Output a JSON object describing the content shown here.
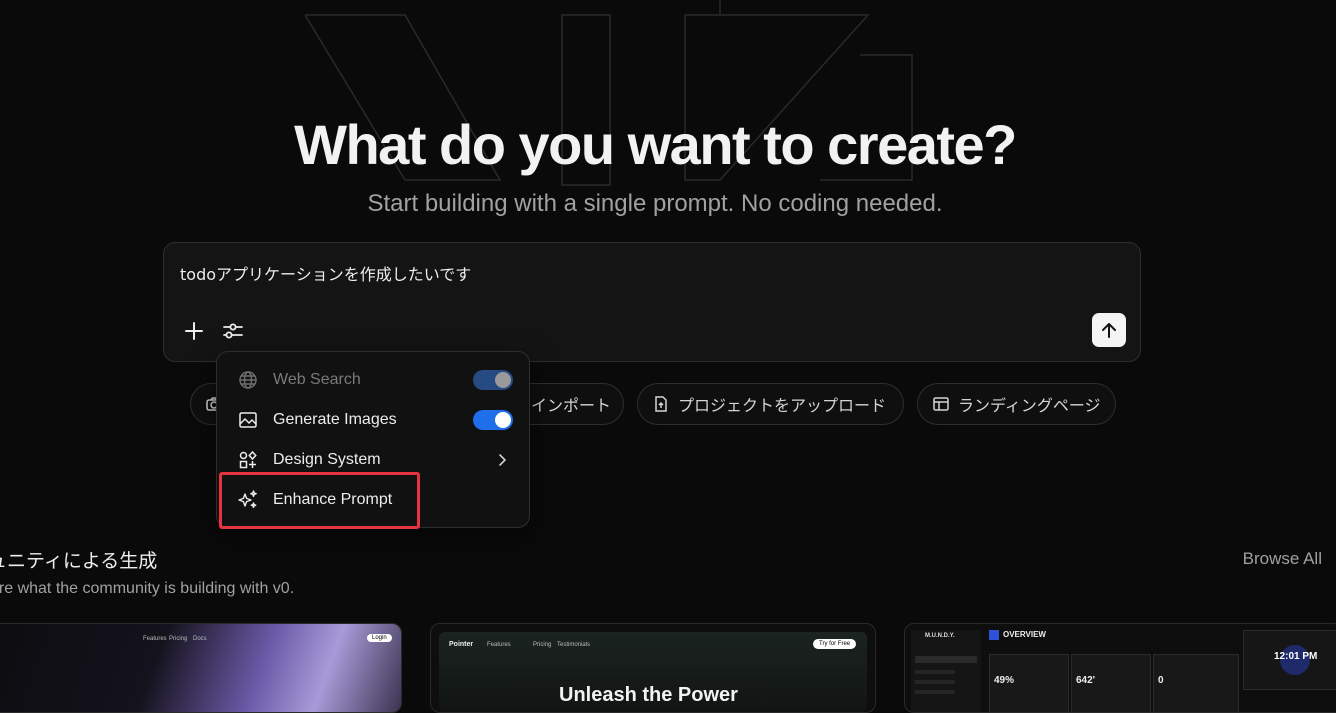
{
  "hero": {
    "title": "What do you want to create?",
    "subtitle": "Start building with a single prompt. No coding needed."
  },
  "prompt": {
    "value": "todoアプリケーションを作成したいです"
  },
  "chips": [
    {
      "label": "",
      "icon": "camera-icon"
    },
    {
      "label": "インポート",
      "icon": "import-icon"
    },
    {
      "label": "プロジェクトをアップロード",
      "icon": "file-upload-icon"
    },
    {
      "label": "ランディングページ",
      "icon": "layout-icon"
    }
  ],
  "menu": {
    "items": [
      {
        "label": "Web Search",
        "icon": "globe-icon",
        "toggle": true,
        "disabled": true
      },
      {
        "label": "Generate Images",
        "icon": "image-icon",
        "toggle": true,
        "disabled": false
      },
      {
        "label": "Design System",
        "icon": "shapes-icon",
        "submenu": true
      },
      {
        "label": "Enhance Prompt",
        "icon": "sparkles-icon"
      }
    ]
  },
  "community": {
    "title": "ュニティによる生成",
    "subtitle": "ore what the community is building with v0.",
    "browse_all": "Browse All"
  },
  "cards": [
    {
      "nav": [
        "Features",
        "Pricing",
        "Docs"
      ],
      "button": "Login"
    },
    {
      "brand": "Pointer",
      "nav": [
        "Features",
        "Pricing",
        "Testimonials"
      ],
      "button": "Try for Free",
      "headline": "Unleash the Power"
    },
    {
      "brand": "M.U.N.D.Y.",
      "heading": "OVERVIEW",
      "stats": [
        "49%",
        "642'",
        "0"
      ],
      "clock": "12:01 PM"
    }
  ],
  "colors": {
    "background": "#0a0a0a",
    "toggle_on": "#1f6feb",
    "highlight": "#e5343f"
  }
}
